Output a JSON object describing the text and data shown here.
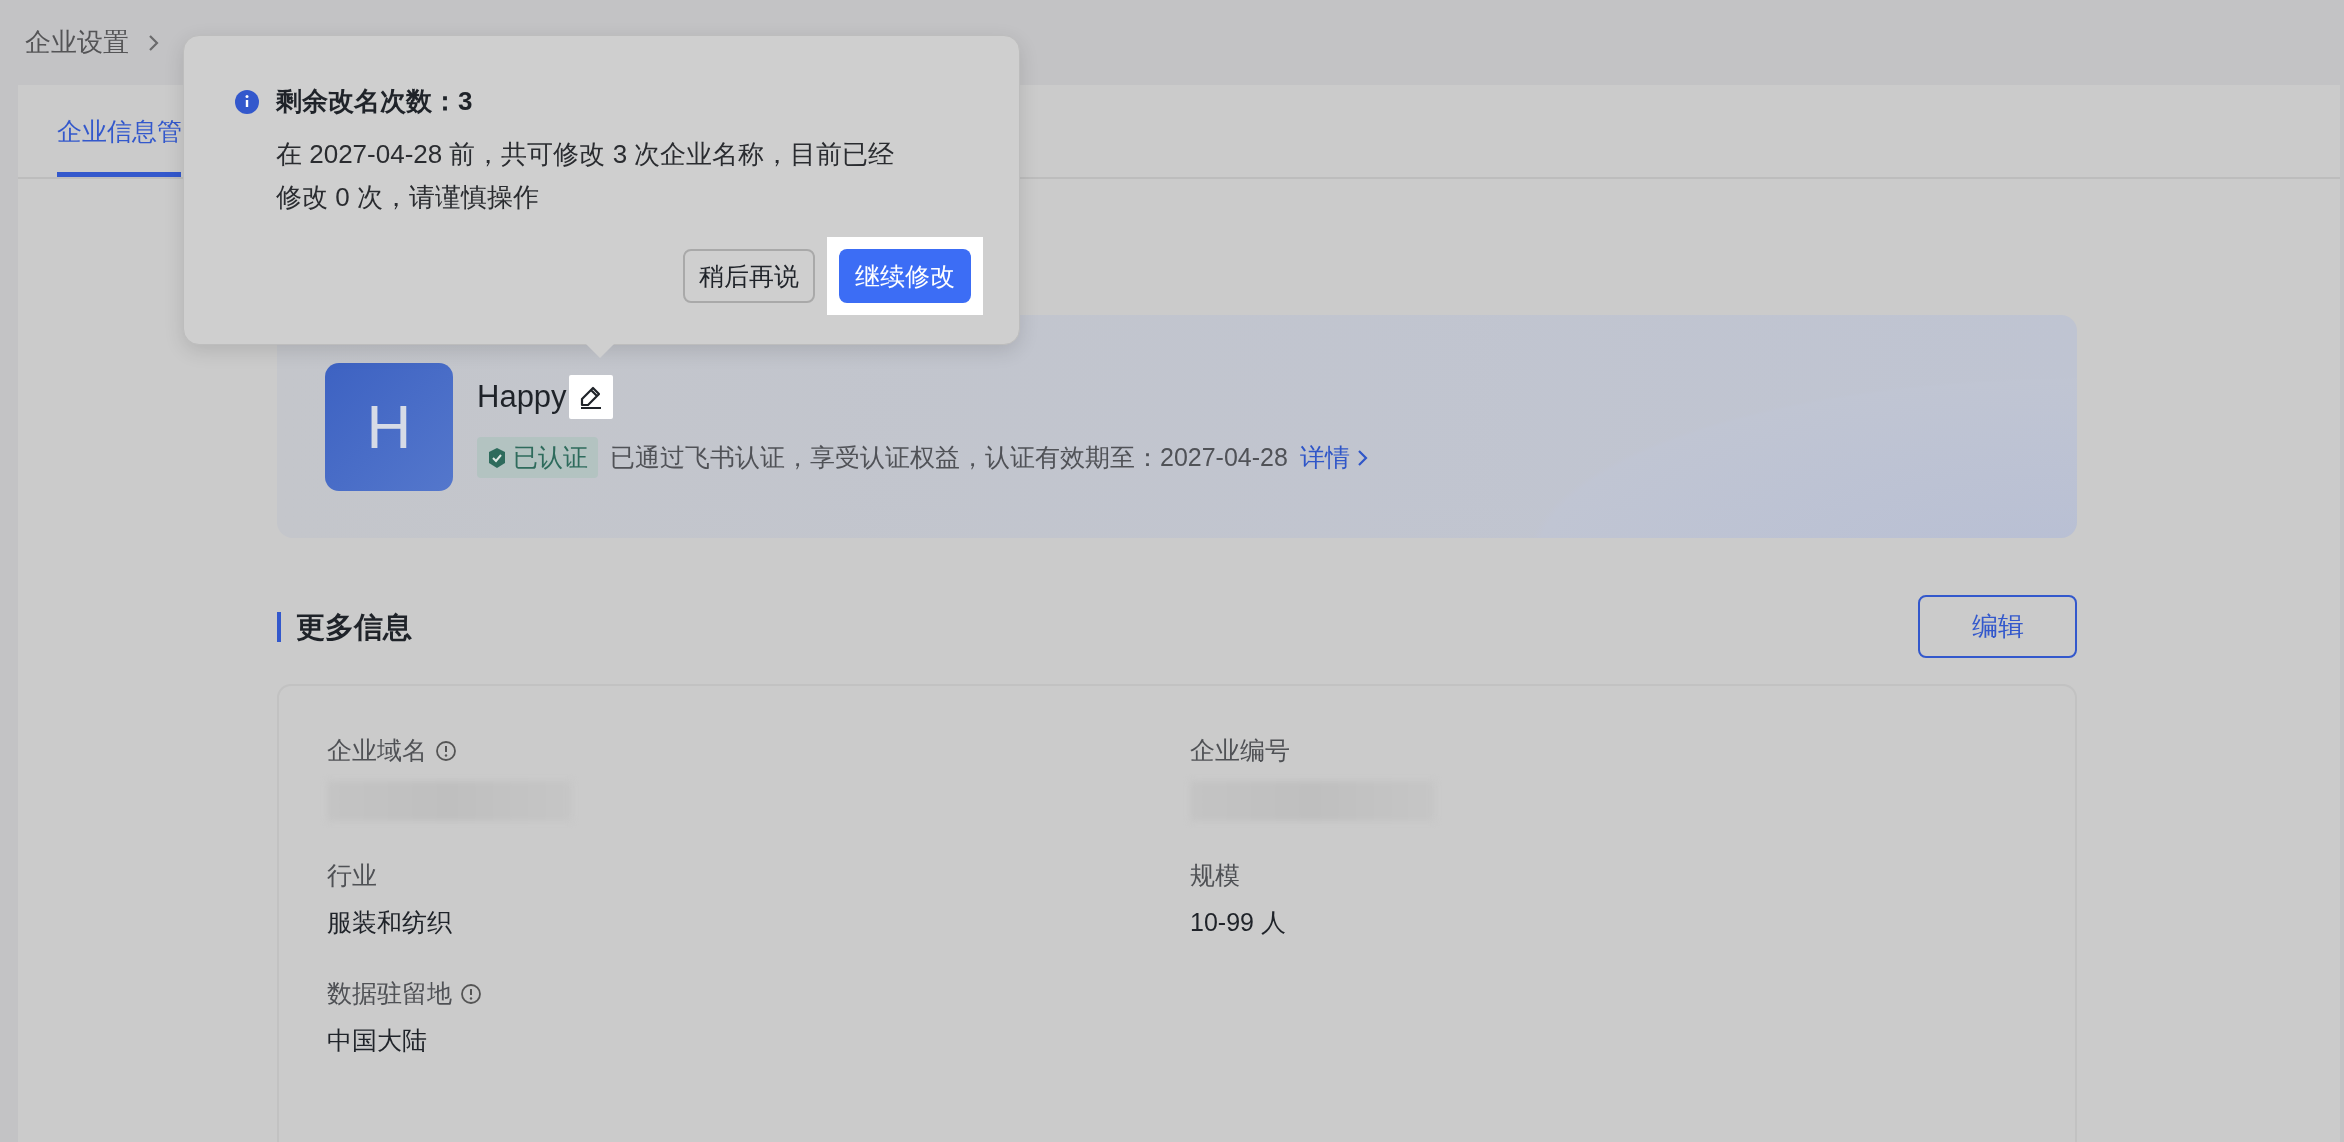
{
  "breadcrumb": [
    {
      "label": "企业设置"
    }
  ],
  "tabs": [
    {
      "label": "企业信息管",
      "selected": true
    }
  ],
  "popover": {
    "title": "剩余改名次数：3",
    "body": "在 2027-04-28 前，共可修改 3 次企业名称，目前已经修改 0 次，请谨慎操作",
    "buttons": [
      {
        "label": "稍后再说",
        "kind": "secondary",
        "highlighted": false
      },
      {
        "label": "继续修改",
        "kind": "primary",
        "highlighted": true
      }
    ]
  },
  "company": {
    "avatar_letter": "H",
    "name": "Happy",
    "edit_highlighted": true,
    "badge": "已认证",
    "status_text": "已通过飞书认证，享受认证权益，认证有效期至：2027-04-28",
    "link": "详情"
  },
  "section": {
    "title": "更多信息",
    "edit_button": "编辑"
  },
  "fields": [
    {
      "label": "企业域名",
      "info": true,
      "redacted": true
    },
    {
      "label": "企业编号",
      "info": false,
      "redacted": true
    },
    {
      "label": "行业",
      "info": false,
      "redacted": false,
      "value": "服装和纺织"
    },
    {
      "label": "规模",
      "info": false,
      "redacted": false,
      "value": "10-99 人"
    },
    {
      "label": "数据驻留地",
      "info": true,
      "redacted": false,
      "value": "中国大陆"
    }
  ]
}
